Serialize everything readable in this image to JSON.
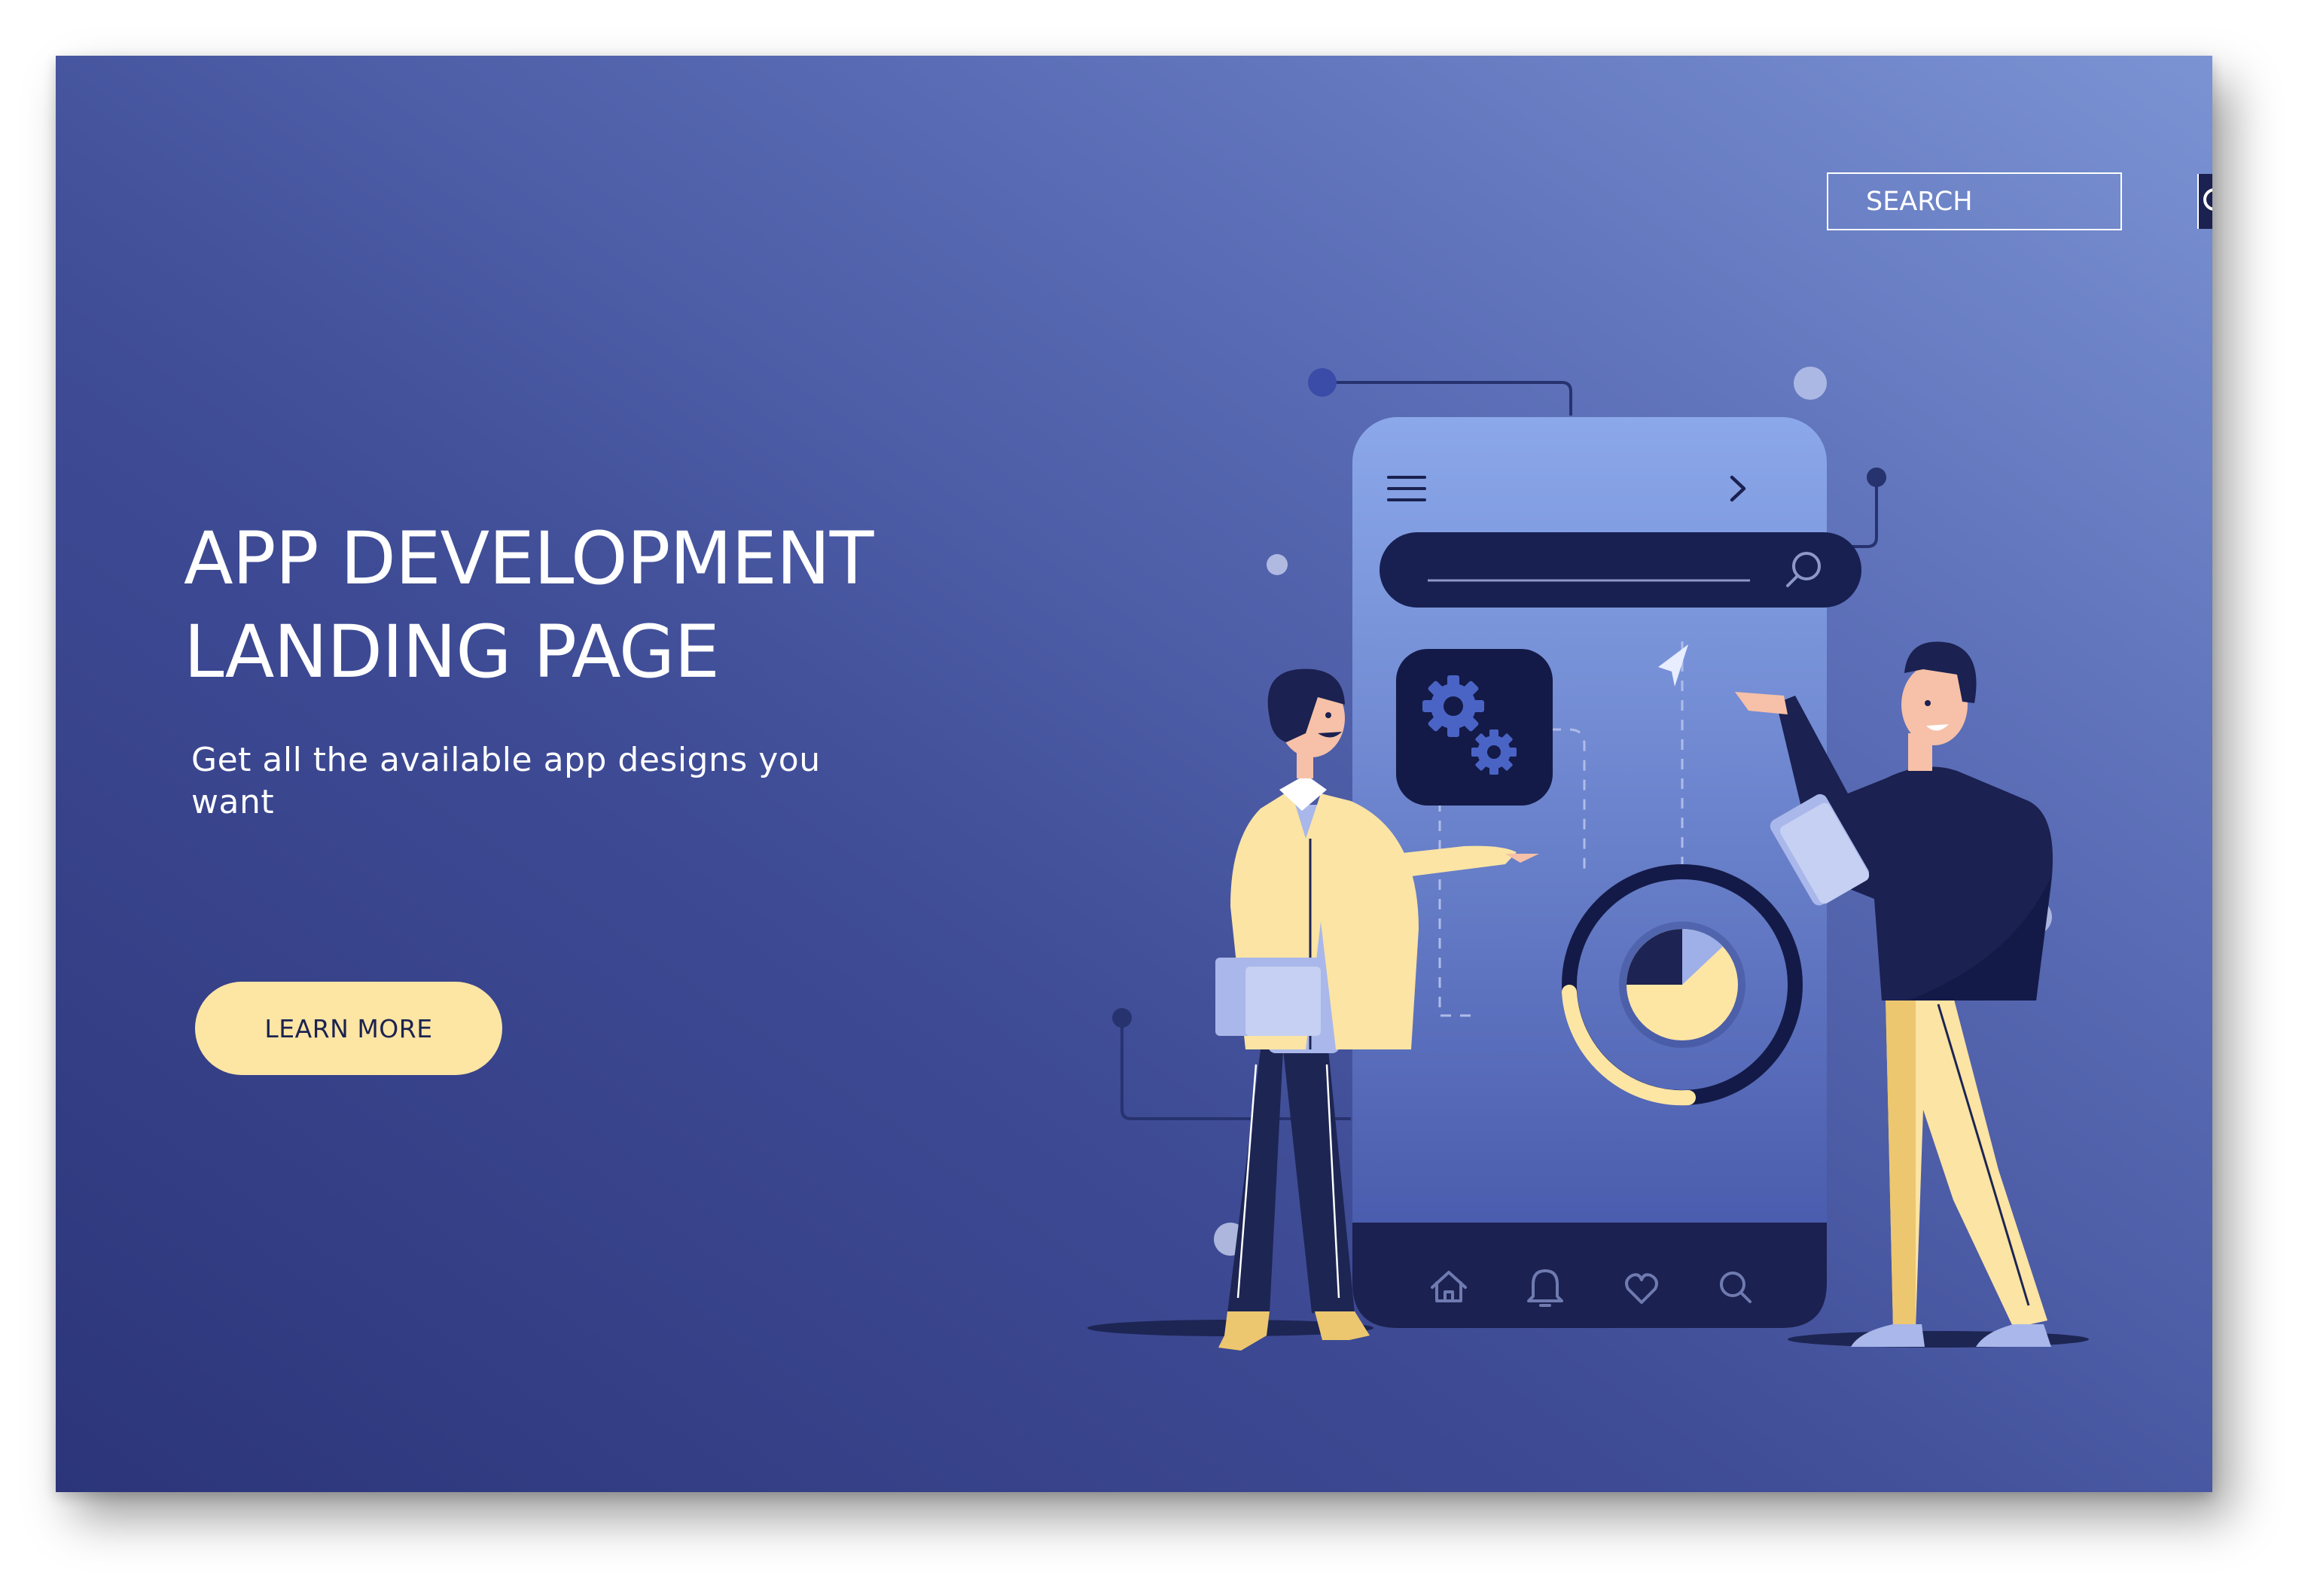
{
  "hero": {
    "title_line1": "APP DEVELOPMENT",
    "title_line2": "LANDING PAGE",
    "subtitle": "Get all the available app designs you want",
    "cta_label": "LEARN MORE"
  },
  "search": {
    "placeholder": "SEARCH",
    "icon": "search-icon"
  },
  "illustration": {
    "phone_menu_icon": "hamburger-menu-icon",
    "phone_next_icon": "chevron-right-icon",
    "phone_search_icon": "search-icon",
    "settings_icon": "gears-icon",
    "cursor_icon": "pointer-arrow-icon",
    "chart_icon": "pie-chart-icon",
    "bottom_nav": [
      "home-icon",
      "bell-icon",
      "heart-icon",
      "search-icon"
    ]
  },
  "colors": {
    "background_dark": "#2c3579",
    "background_light": "#7b93d3",
    "accent_yellow": "#fde5a4",
    "navy": "#1b2150",
    "phone_top": "#8ba8ea",
    "phone_bottom": "#4253a6"
  }
}
